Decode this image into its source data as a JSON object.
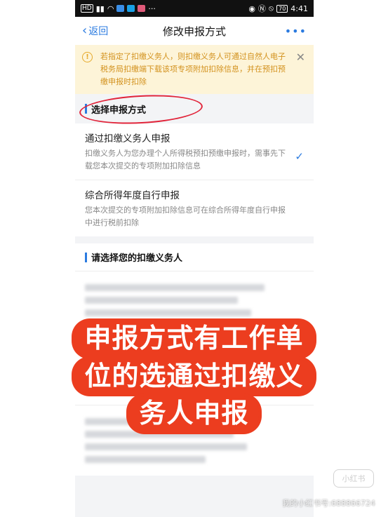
{
  "status_bar": {
    "left_icons": [
      "HD",
      "4G",
      "signal",
      "wifi",
      "app-icons"
    ],
    "time": "4:41",
    "battery": "70"
  },
  "nav": {
    "back_label": "返回",
    "title": "修改申报方式",
    "more_label": "•••"
  },
  "notice": {
    "text": "若指定了扣缴义务人，则扣缴义务人可通过自然人电子税务局扣缴端下载该项专项附加扣除信息，并在预扣预缴申报时扣除",
    "close_label": "✕"
  },
  "method_section": {
    "heading": "选择申报方式",
    "options": [
      {
        "title": "通过扣缴义务人申报",
        "desc": "扣缴义务人为您办理个人所得税预扣预缴申报时，需事先下载您本次提交的专项附加扣除信息",
        "selected": true
      },
      {
        "title": "综合所得年度自行申报",
        "desc": "您本次提交的专项附加扣除信息可在综合所得年度自行申报中进行税前扣除",
        "selected": false
      }
    ]
  },
  "withholder_section": {
    "heading": "请选择您的扣缴义务人"
  },
  "overlay": {
    "lines": [
      "申报方式有工作单",
      "位的选通过扣缴义",
      "务人申报"
    ]
  },
  "watermark": {
    "logo": "小红书",
    "text": "我的小红书号:688866724"
  },
  "colors": {
    "accent": "#2b7be0",
    "notice_bg": "#fdf4d8",
    "notice_text": "#d3921e",
    "overlay_bg": "#ec3d1f",
    "annotation_circle": "#e1243a"
  }
}
